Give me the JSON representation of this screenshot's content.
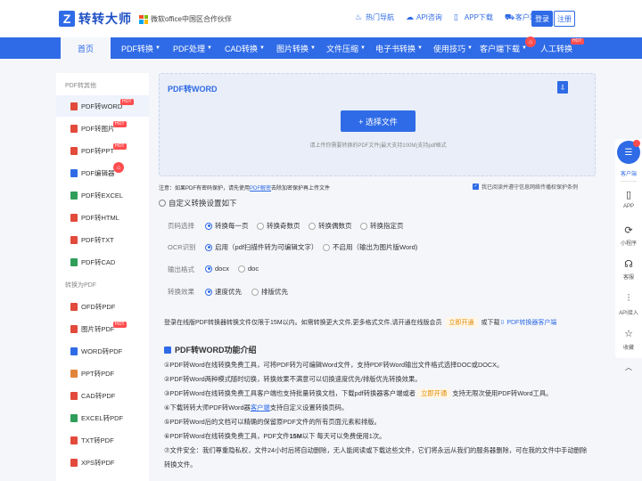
{
  "header": {
    "logo_glyph": "Z",
    "logo_text": "转转大师",
    "partner_text": "微软office中国区合作伙伴",
    "links": [
      {
        "label": "热门导航",
        "icon": "fire-icon"
      },
      {
        "label": "API咨询",
        "icon": "cloud-icon"
      },
      {
        "label": "APP下载",
        "icon": "phone-icon"
      },
      {
        "label": "客户端",
        "icon": "cart-icon"
      }
    ],
    "login": "登录",
    "register": "注册"
  },
  "nav": {
    "items": [
      {
        "label": "首页"
      },
      {
        "label": "PDF转换"
      },
      {
        "label": "PDF处理"
      },
      {
        "label": "CAD转换"
      },
      {
        "label": "图片转换"
      },
      {
        "label": "文件压缩"
      },
      {
        "label": "电子书转换"
      },
      {
        "label": "使用技巧"
      },
      {
        "label": "客户端下载"
      },
      {
        "label": "人工转换"
      }
    ],
    "hot_label": "HOT"
  },
  "sidebar": {
    "group1": "PDF转其他",
    "group2": "转换为PDF",
    "hot_label": "HOT",
    "items1": [
      {
        "label": "PDF转WORD",
        "color": "#e24a3b"
      },
      {
        "label": "PDF转图片",
        "color": "#e24a3b"
      },
      {
        "label": "PDF转PPT",
        "color": "#e24a3b"
      },
      {
        "label": "PDF编辑器",
        "color": "#2f6be6"
      },
      {
        "label": "PDF转EXCEL",
        "color": "#2f9e5a"
      },
      {
        "label": "PDF转HTML",
        "color": "#e24a3b"
      },
      {
        "label": "PDF转TXT",
        "color": "#e24a3b"
      },
      {
        "label": "PDF转CAD",
        "color": "#2f9e5a"
      }
    ],
    "items2": [
      {
        "label": "OFD转PDF",
        "color": "#e24a3b"
      },
      {
        "label": "图片转PDF",
        "color": "#e24a3b"
      },
      {
        "label": "WORD转PDF",
        "color": "#2f6be6"
      },
      {
        "label": "PPT转PDF",
        "color": "#e2853b"
      },
      {
        "label": "CAD转PDF",
        "color": "#e24a3b"
      },
      {
        "label": "EXCEL转PDF",
        "color": "#2f9e5a"
      },
      {
        "label": "TXT转PDF",
        "color": "#e24a3b"
      },
      {
        "label": "XPS转PDF",
        "color": "#e24a3b"
      }
    ]
  },
  "upload": {
    "title": "PDF转WORD",
    "button": "+ 选择文件",
    "hint": "请上传你需要转换的PDF文件(最大支持100M)支持pdf格式"
  },
  "notice": {
    "prefix": "注意：如果PDF有密码保护，请先使用",
    "link": "PDF解密",
    "suffix": "去除加密保护再上传文件",
    "agree": "我已阅读并遵守信息网络传播权保护条例"
  },
  "options": {
    "title": "自定义转换设置如下",
    "rows": [
      {
        "label": "页码选择",
        "choices": [
          "转换每一页",
          "转换奇数页",
          "转换偶数页",
          "转换指定页"
        ],
        "selected": 0
      },
      {
        "label": "OCR识别",
        "choices": [
          "启用（pdf扫描件转为可编辑文字）",
          "不启用（输出为图片版Word)"
        ],
        "selected": 0
      },
      {
        "label": "输出格式",
        "choices": [
          "docx",
          "doc"
        ],
        "selected": 0
      },
      {
        "label": "转换效果",
        "choices": [
          "速度优先",
          "排版优先"
        ],
        "selected": 0
      }
    ]
  },
  "limit": {
    "text": "登录在线版PDF转换器转换文件仅限于15M以内。如需转换更大文件,更多格式文件,请开通在线版会员",
    "tag": "立即开通",
    "or": "或下载",
    "link": "PDF转换器客户端"
  },
  "intro": {
    "title": "PDF转WORD功能介绍",
    "l1": "①PDF转Word在线转换免费工具，可将PDF转为可编辑Word文件，支持PDF转Word输出文件格式选择DOC或DOCX。",
    "l2": "②PDF转Word两种模式随时切换，转换效果不满意可以切换速度优先/排版优先转换效果。",
    "l3a": "③PDF转Word在线转换免费工具客户端也支持批量转换文档，下载pdf转换器客户端或者",
    "l3tag": "立即开通",
    "l3b": "支持无限次使用PDF转Word工具。",
    "l4a": "④下载转转大师PDF转Word器",
    "l4link": "客户端",
    "l4b": "支持自定义设置转换页码。",
    "l5": "⑤PDF转Word后的文档可以精确的保留原PDF文件的所有页面元素和排版。",
    "l6a": "⑥PDF转Word在线转换免费工具，PDF文件",
    "l6b": "15M",
    "l6c": "以下 每天可以免费使用1次。",
    "l7a": "⑦文件安全：我们尊重隐私权，文件24小时后将自动删除，无人能阅读或下载这些文件，它们将永远从我们的服务器删除，可在我的文件中手动删除",
    "l7b": "转换文件。"
  },
  "dock": {
    "items": [
      {
        "label": "客户端",
        "icon": "client-icon"
      },
      {
        "label": "APP",
        "icon": "mobile-icon"
      },
      {
        "label": "小程序",
        "icon": "miniapp-icon"
      },
      {
        "label": "客服",
        "icon": "headset-icon"
      },
      {
        "label": "API接入",
        "icon": "api-icon"
      },
      {
        "label": "收藏",
        "icon": "star-icon"
      }
    ]
  }
}
